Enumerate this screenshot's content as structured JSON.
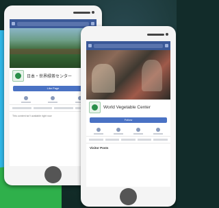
{
  "page_a": {
    "name": "日本・世界緑茶センター",
    "sub": "",
    "like": "Like Page",
    "post": "This content isn't available right now"
  },
  "page_b": {
    "name": "World Vegetable Center",
    "sub": "",
    "like": "Follow",
    "section": "Visitor Posts"
  },
  "colors": {
    "fb_blue": "#3b5998",
    "accent_green": "#2fb04b",
    "accent_cyan": "#31b8e8"
  }
}
